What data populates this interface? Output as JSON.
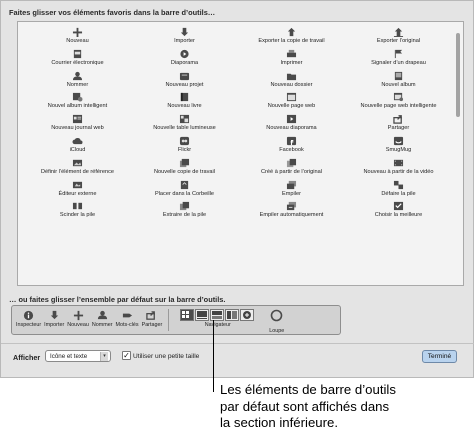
{
  "window": {
    "drag_hint": "Faites glisser vos éléments favoris dans la barre d’outils…",
    "default_hint": "… ou faites glisser l’ensemble par défaut sur la barre d’outils."
  },
  "palette": {
    "items": [
      {
        "icon": "plus-icon",
        "label": "Nouveau"
      },
      {
        "icon": "import-arrow-icon",
        "label": "Importer"
      },
      {
        "icon": "export-copy-icon",
        "label": "Exporter la copie de travail"
      },
      {
        "icon": "export-original-icon",
        "label": "Exporter l’original"
      },
      {
        "icon": "mail-icon",
        "label": "Courrier électronique"
      },
      {
        "icon": "slideshow-play-icon",
        "label": "Diaporama"
      },
      {
        "icon": "printer-icon",
        "label": "Imprimer"
      },
      {
        "icon": "flag-icon",
        "label": "Signaler d’un drapeau"
      },
      {
        "icon": "person-icon",
        "label": "Nommer"
      },
      {
        "icon": "project-icon",
        "label": "Nouveau projet"
      },
      {
        "icon": "folder-icon",
        "label": "Nouveau dossier"
      },
      {
        "icon": "album-icon",
        "label": "Nouvel album"
      },
      {
        "icon": "smart-album-icon",
        "label": "Nouvel album intelligent"
      },
      {
        "icon": "book-icon",
        "label": "Nouveau livre"
      },
      {
        "icon": "webpage-icon",
        "label": "Nouvelle page web"
      },
      {
        "icon": "smart-webpage-icon",
        "label": "Nouvelle page web intelligente"
      },
      {
        "icon": "web-journal-icon",
        "label": "Nouveau journal web"
      },
      {
        "icon": "light-table-icon",
        "label": "Nouvelle table lumineuse"
      },
      {
        "icon": "new-slideshow-icon",
        "label": "Nouveau diaporama"
      },
      {
        "icon": "share-icon",
        "label": "Partager"
      },
      {
        "icon": "cloud-icon",
        "label": "iCloud"
      },
      {
        "icon": "flickr-icon",
        "label": "Flickr"
      },
      {
        "icon": "facebook-icon",
        "label": "Facebook"
      },
      {
        "icon": "smugmug-icon",
        "label": "SmugMug"
      },
      {
        "icon": "pick-icon",
        "label": "Définir l’élément de référence"
      },
      {
        "icon": "version-icon",
        "label": "Nouvelle copie de travail"
      },
      {
        "icon": "duplicate-icon",
        "label": "Créé à partir de l’original"
      },
      {
        "icon": "video-frame-icon",
        "label": "Nouveau à partir de la vidéo"
      },
      {
        "icon": "external-editor-icon",
        "label": "Éditeur externe"
      },
      {
        "icon": "trash-icon",
        "label": "Placer dans la Corbeille"
      },
      {
        "icon": "stack-icon",
        "label": "Empiler"
      },
      {
        "icon": "unstack-icon",
        "label": "Défaire la pile"
      },
      {
        "icon": "split-stack-icon",
        "label": "Scinder la pile"
      },
      {
        "icon": "extract-icon",
        "label": "Extraire de la pile"
      },
      {
        "icon": "auto-stack-icon",
        "label": "Empiler automatiquement"
      },
      {
        "icon": "best-pick-icon",
        "label": "Choisir la meilleure"
      }
    ]
  },
  "default_toolbar": {
    "items": [
      {
        "icon": "info-icon",
        "label": "Inspecteur"
      },
      {
        "icon": "import-arrow-icon",
        "label": "Importer"
      },
      {
        "icon": "plus-icon",
        "label": "Nouveau"
      },
      {
        "icon": "person-icon",
        "label": "Nommer"
      },
      {
        "icon": "keyword-tag-icon",
        "label": "Mots-clés"
      },
      {
        "icon": "share-icon",
        "label": "Partager"
      }
    ],
    "navigator_label": "Navigateur",
    "navigator_buttons": [
      "grid-view-icon",
      "viewer-icon",
      "split-view-icon",
      "browser-icon",
      "map-icon"
    ],
    "loupe_label": "Loupe"
  },
  "bottom": {
    "show_label": "Afficher",
    "show_value": "Icône et texte",
    "small_size_label": "Utiliser une petite taille",
    "small_size_checked": true,
    "done_label": "Terminé"
  },
  "callout": {
    "line1": "Les éléments de barre d’outils",
    "line2": "par défaut sont affichés dans",
    "line3": "la section inférieure."
  }
}
